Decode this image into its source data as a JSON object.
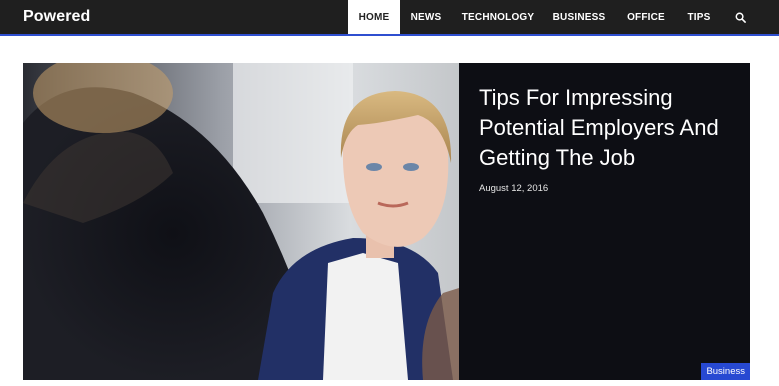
{
  "site": {
    "logo": "Powered"
  },
  "nav": {
    "items": [
      "HOME",
      "NEWS",
      "TECHNOLOGY",
      "BUSINESS",
      "OFFICE",
      "TIPS"
    ],
    "active": "HOME",
    "search_icon": "search-icon"
  },
  "featured": {
    "title": "Tips For Impressing Potential Employers And Getting The Job",
    "date": "August 12, 2016",
    "category": "Business"
  },
  "colors": {
    "topbar": "#1f1f1f",
    "nav_underline": "#2f4fd0",
    "badge": "#2749d2",
    "hero_dark_panel": "#0d0e14"
  }
}
